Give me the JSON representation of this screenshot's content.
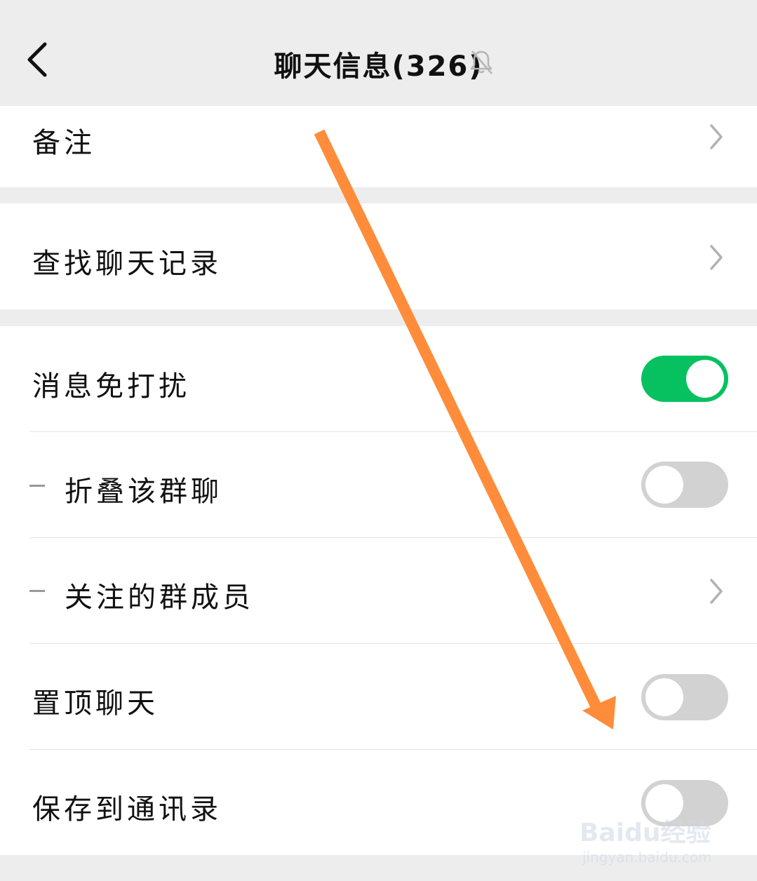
{
  "header": {
    "title": "聊天信息(326)"
  },
  "sections": {
    "remark": {
      "label": "备注"
    },
    "search_history": {
      "label": "查找聊天记录"
    },
    "mute": {
      "label": "消息免打扰",
      "enabled": true
    },
    "fold_group": {
      "label": "折叠该群聊",
      "enabled": false
    },
    "followed_members": {
      "label": "关注的群成员"
    },
    "pin_chat": {
      "label": "置顶聊天",
      "enabled": false
    },
    "save_to_contacts": {
      "label": "保存到通讯录",
      "enabled": false
    }
  },
  "annotation": {
    "arrow_color": "#ff8c3a"
  },
  "watermark": {
    "brand": "Baidu经验",
    "url": "jingyan.baidu.com"
  },
  "colors": {
    "accent_green": "#07c160",
    "toggle_off": "#d2d2d2",
    "page_bg": "#ededed"
  }
}
